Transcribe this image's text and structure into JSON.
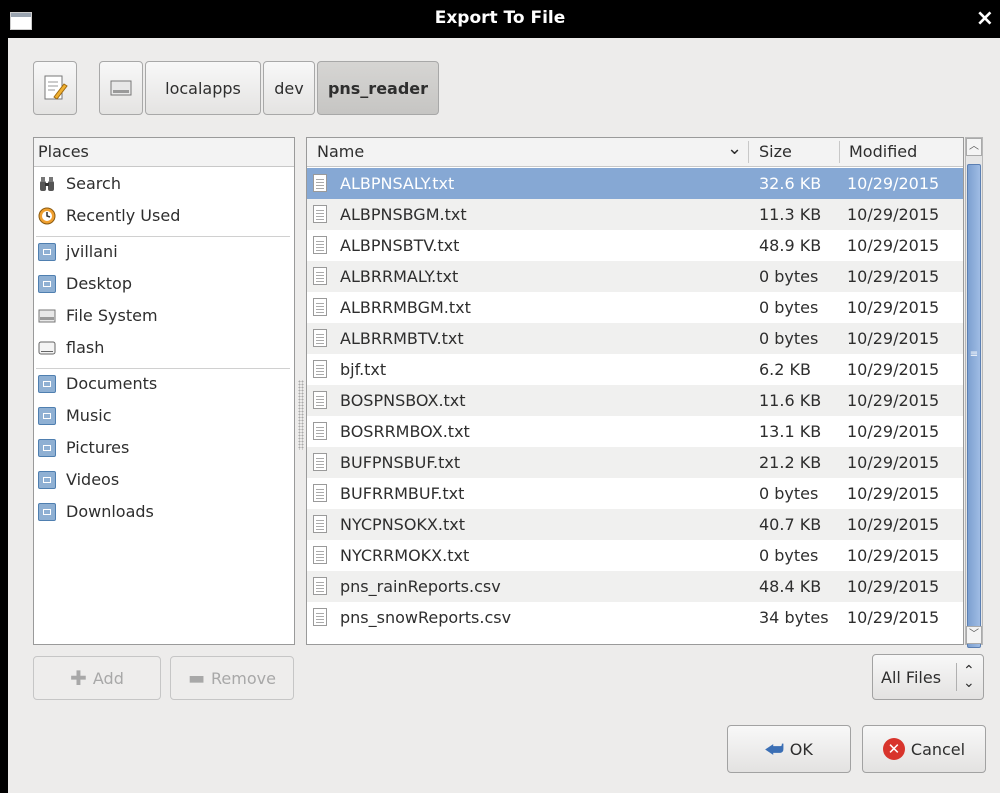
{
  "window": {
    "title": "Export To File",
    "close_glyph": "×"
  },
  "pathbar": {
    "segments": [
      "localapps",
      "dev",
      "pns_reader"
    ]
  },
  "places": {
    "header": "Places",
    "items": [
      {
        "label": "Search",
        "icon": "binoculars-icon"
      },
      {
        "label": "Recently Used",
        "icon": "clock-icon"
      },
      {
        "label": "jvillani",
        "icon": "home-folder-icon"
      },
      {
        "label": "Desktop",
        "icon": "desktop-folder-icon"
      },
      {
        "label": "File System",
        "icon": "drive-icon"
      },
      {
        "label": "flash",
        "icon": "removable-drive-icon"
      },
      {
        "label": "Documents",
        "icon": "documents-folder-icon"
      },
      {
        "label": "Music",
        "icon": "music-folder-icon"
      },
      {
        "label": "Pictures",
        "icon": "pictures-folder-icon"
      },
      {
        "label": "Videos",
        "icon": "videos-folder-icon"
      },
      {
        "label": "Downloads",
        "icon": "downloads-folder-icon"
      }
    ]
  },
  "filelist": {
    "columns": {
      "name": "Name",
      "sort_glyph": "⌄",
      "size": "Size",
      "modified": "Modified"
    },
    "rows": [
      {
        "name": "ALBPNSALY.txt",
        "size": "32.6 KB",
        "modified": "10/29/2015",
        "selected": true
      },
      {
        "name": "ALBPNSBGM.txt",
        "size": "11.3 KB",
        "modified": "10/29/2015"
      },
      {
        "name": "ALBPNSBTV.txt",
        "size": "48.9 KB",
        "modified": "10/29/2015"
      },
      {
        "name": "ALBRRMALY.txt",
        "size": "0 bytes",
        "modified": "10/29/2015"
      },
      {
        "name": "ALBRRMBGM.txt",
        "size": "0 bytes",
        "modified": "10/29/2015"
      },
      {
        "name": "ALBRRMBTV.txt",
        "size": "0 bytes",
        "modified": "10/29/2015"
      },
      {
        "name": "bjf.txt",
        "size": "6.2 KB",
        "modified": "10/29/2015"
      },
      {
        "name": "BOSPNSBOX.txt",
        "size": "11.6 KB",
        "modified": "10/29/2015"
      },
      {
        "name": "BOSRRMBOX.txt",
        "size": "13.1 KB",
        "modified": "10/29/2015"
      },
      {
        "name": "BUFPNSBUF.txt",
        "size": "21.2 KB",
        "modified": "10/29/2015"
      },
      {
        "name": "BUFRRMBUF.txt",
        "size": "0 bytes",
        "modified": "10/29/2015"
      },
      {
        "name": "NYCPNSOKX.txt",
        "size": "40.7 KB",
        "modified": "10/29/2015"
      },
      {
        "name": "NYCRRMOKX.txt",
        "size": "0 bytes",
        "modified": "10/29/2015"
      },
      {
        "name": "pns_rainReports.csv",
        "size": "48.4 KB",
        "modified": "10/29/2015"
      },
      {
        "name": "pns_snowReports.csv",
        "size": "34 bytes",
        "modified": "10/29/2015"
      }
    ]
  },
  "buttons": {
    "add": "Add",
    "remove": "Remove",
    "filter": "All Files",
    "ok": "OK",
    "cancel": "Cancel"
  },
  "colors": {
    "selection": "#86a8d4",
    "titlebar": "#000000",
    "cancel_red": "#d8342c"
  }
}
